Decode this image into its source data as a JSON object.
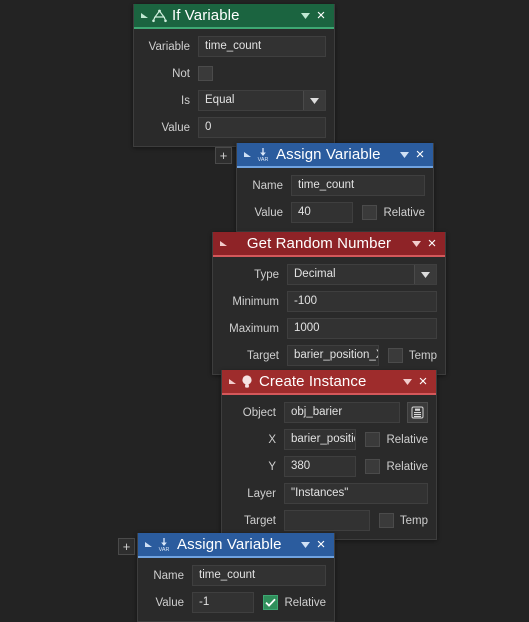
{
  "canvas": {
    "background": "#232323",
    "wire_color_green": "#2f6b45",
    "wire_color_gray": "#555555"
  },
  "colors": {
    "green_header": "#1b6440",
    "blue_header": "#2b5c9e",
    "red_header": "#8e2327",
    "checked_green": "#2f8f5b"
  },
  "common": {
    "expand_label": "+",
    "close_label": "×",
    "relative_label": "Relative",
    "temp_label": "Temp"
  },
  "blocks": [
    {
      "id": "if-variable",
      "title": "If Variable",
      "icon": "branch-icon",
      "color": "green",
      "fields": [
        {
          "label": "Variable",
          "value": "time_count",
          "type": "text"
        },
        {
          "label": "Not",
          "value": "",
          "type": "checkbox",
          "checked": false
        },
        {
          "label": "Is",
          "value": "Equal",
          "type": "dropdown"
        },
        {
          "label": "Value",
          "value": "0",
          "type": "text"
        }
      ]
    },
    {
      "id": "assign-variable-top",
      "title": "Assign Variable",
      "icon": "var-icon",
      "color": "blue",
      "has_plus": true,
      "fields": [
        {
          "label": "Name",
          "value": "time_count",
          "type": "text"
        },
        {
          "label": "Value",
          "value": "40",
          "type": "text",
          "checkbox_label": "Relative",
          "checked": false
        }
      ]
    },
    {
      "id": "get-random-number",
      "title": "Get Random Number",
      "icon": "none",
      "color": "red",
      "fields": [
        {
          "label": "Type",
          "value": "Decimal",
          "type": "dropdown"
        },
        {
          "label": "Minimum",
          "value": "-100",
          "type": "text"
        },
        {
          "label": "Maximum",
          "value": "1000",
          "type": "text"
        },
        {
          "label": "Target",
          "value": "barier_position_X",
          "type": "text",
          "checkbox_label": "Temp",
          "checked": false
        }
      ]
    },
    {
      "id": "create-instance",
      "title": "Create Instance",
      "icon": "lightbulb-icon",
      "color": "red",
      "fields": [
        {
          "label": "Object",
          "value": "obj_barier",
          "type": "text",
          "picker": true
        },
        {
          "label": "X",
          "value": "barier_position_X",
          "type": "text",
          "checkbox_label": "Relative",
          "checked": false
        },
        {
          "label": "Y",
          "value": "380",
          "type": "text",
          "checkbox_label": "Relative",
          "checked": false
        },
        {
          "label": "Layer",
          "value": "\"Instances\"",
          "type": "text"
        },
        {
          "label": "Target",
          "value": "",
          "type": "text",
          "checkbox_label": "Temp",
          "checked": false
        }
      ]
    },
    {
      "id": "assign-variable-bottom",
      "title": "Assign Variable",
      "icon": "var-icon",
      "color": "blue",
      "has_plus": true,
      "fields": [
        {
          "label": "Name",
          "value": "time_count",
          "type": "text"
        },
        {
          "label": "Value",
          "value": "-1",
          "type": "text",
          "checkbox_label": "Relative",
          "checked": true
        }
      ]
    }
  ]
}
